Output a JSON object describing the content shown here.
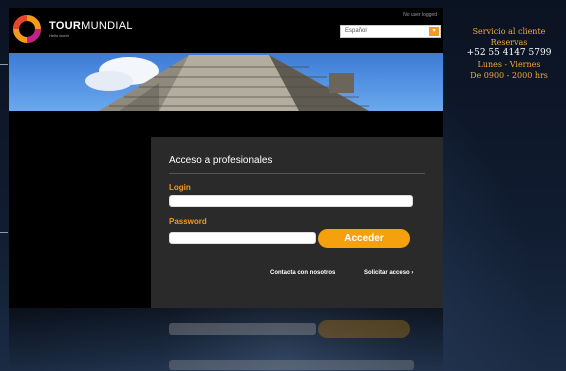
{
  "header": {
    "logo_word_bold": "TOUR",
    "logo_word_rest": "MUNDIAL",
    "logo_tagline": "Hello world",
    "status": "No user logged",
    "language_selected": "Español"
  },
  "service": {
    "title": "Servicio al cliente",
    "subtitle": "Reservas",
    "phone": "+52 55 4147 5799",
    "days": "Lunes - Viernes",
    "hours": "De 0900 - 2000 hrs"
  },
  "login": {
    "title": "Acceso a profesionales",
    "login_label": "Login",
    "login_value": "",
    "password_label": "Password",
    "password_value": "",
    "submit_label": "Acceder",
    "contact_link": "Contacta con nosotros",
    "request_link": "Solicitar acceso"
  },
  "colors": {
    "accent": "#f4a10d",
    "panel": "#2a2a2a",
    "service_text": "#f0a93a"
  },
  "icons": [
    "tourmundial-logo-icon",
    "chevron-down-icon",
    "chevron-right-icon"
  ]
}
